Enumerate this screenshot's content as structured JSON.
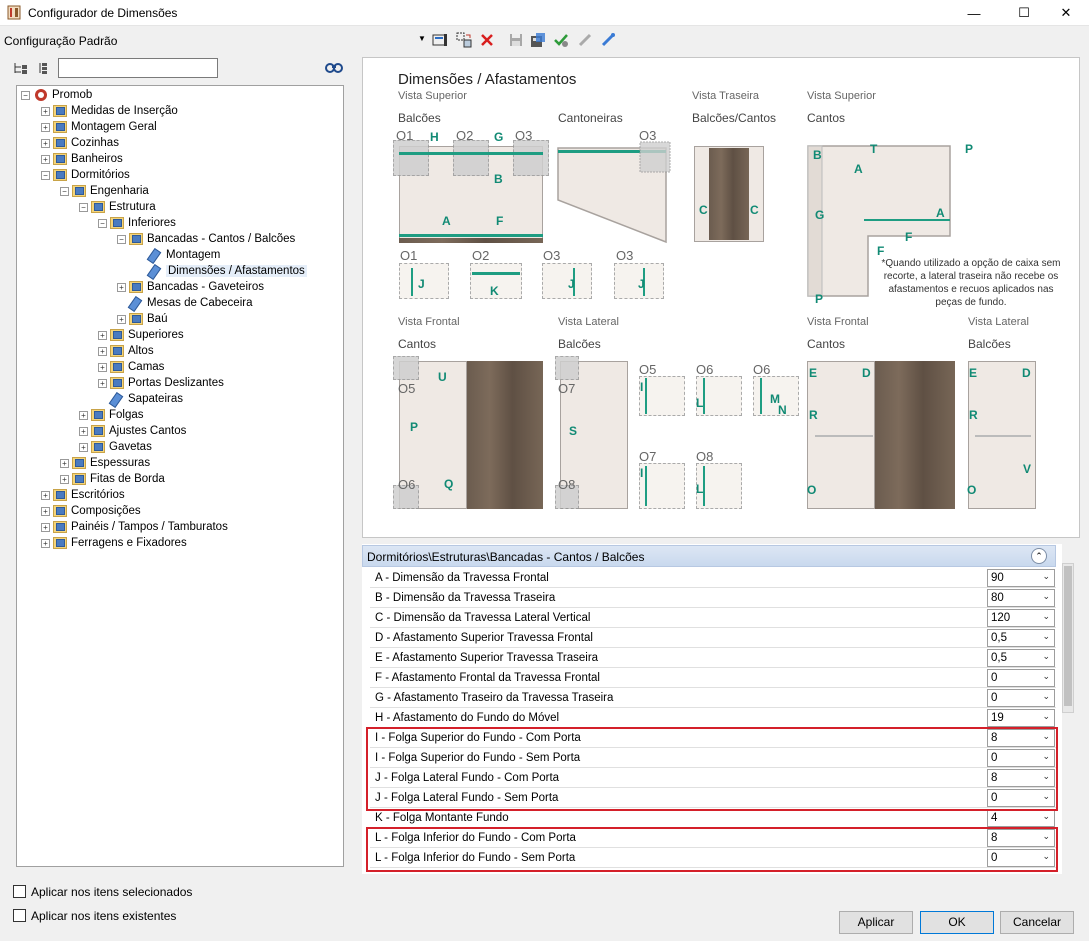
{
  "window": {
    "title": "Configurador de Dimensões",
    "minimize": "—",
    "maximize": "☐",
    "close": "✕"
  },
  "config": {
    "label": "Configuração Padrão",
    "arrow": "▼"
  },
  "toolbar": {
    "icons": [
      "edit-icon",
      "swap-icon",
      "delete-icon",
      "save-icon",
      "export-icon",
      "check-icon",
      "link-icon",
      "unlink-icon"
    ]
  },
  "tree": {
    "root": "Promob",
    "items": [
      "Medidas de Inserção",
      "Montagem Geral",
      "Cozinhas",
      "Banheiros",
      "Dormitórios",
      "Engenharia",
      "Estrutura",
      "Inferiores",
      "Bancadas - Cantos / Balcões",
      "Montagem",
      "Dimensões / Afastamentos",
      "Bancadas - Gaveteiros",
      "Mesas de Cabeceira",
      "Baú",
      "Superiores",
      "Altos",
      "Camas",
      "Portas Deslizantes",
      "Sapateiras",
      "Folgas",
      "Ajustes Cantos",
      "Gavetas",
      "Espessuras",
      "Fitas de Borda",
      "Escritórios",
      "Composições",
      "Painéis / Tampos / Tamburatos",
      "Ferragens e Fixadores"
    ]
  },
  "image": {
    "title": "Dimensões / Afastamentos",
    "vista_superior": "Vista Superior",
    "vista_traseira": "Vista Traseira",
    "vista_frontal": "Vista Frontal",
    "vista_lateral": "Vista Lateral",
    "balcoes": "Balcões",
    "cantoneiras": "Cantoneiras",
    "balcoes_cantos": "Balcões/Cantos",
    "cantos": "Cantos",
    "note": "*Quando utilizado a opção de caixa sem recorte, a lateral traseira não recebe os afastamentos e recuos aplicados nas peças de fundo.",
    "o1": "O1",
    "o2": "O2",
    "o3": "O3",
    "o5": "O5",
    "o6": "O6",
    "o7": "O7",
    "o8": "O8",
    "letters": {
      "A": "A",
      "B": "B",
      "C": "C",
      "D": "D",
      "E": "E",
      "F": "F",
      "G": "G",
      "H": "H",
      "I": "I",
      "J": "J",
      "K": "K",
      "L": "L",
      "M": "M",
      "N": "N",
      "O": "O",
      "P": "P",
      "Q": "Q",
      "R": "R",
      "S": "S",
      "T": "T",
      "U": "U",
      "V": "V"
    }
  },
  "props": {
    "header": "Dormitórios\\Estruturas\\Bancadas - Cantos / Balcões",
    "collapse": "⌃",
    "rows": [
      {
        "name": "A - Dimensão da Travessa Frontal",
        "value": "90"
      },
      {
        "name": "B - Dimensão da Travessa Traseira",
        "value": "80"
      },
      {
        "name": "C - Dimensão da Travessa Lateral Vertical",
        "value": "120"
      },
      {
        "name": "D - Afastamento Superior Travessa Frontal",
        "value": "0,5"
      },
      {
        "name": "E - Afastamento Superior Travessa Traseira",
        "value": "0,5"
      },
      {
        "name": "F - Afastamento Frontal da Travessa Frontal",
        "value": "0"
      },
      {
        "name": "G - Afastamento Traseiro da Travessa Traseira",
        "value": "0"
      },
      {
        "name": "H - Afastamento do Fundo do Móvel",
        "value": "19"
      },
      {
        "name": "I - Folga Superior do Fundo - Com Porta",
        "value": "8"
      },
      {
        "name": "I - Folga Superior do Fundo - Sem Porta",
        "value": "0"
      },
      {
        "name": "J - Folga Lateral Fundo - Com Porta",
        "value": "8"
      },
      {
        "name": "J - Folga Lateral Fundo - Sem Porta",
        "value": "0"
      },
      {
        "name": "K - Folga Montante Fundo",
        "value": "4"
      },
      {
        "name": "L - Folga Inferior do Fundo - Com Porta",
        "value": "8"
      },
      {
        "name": "L - Folga Inferior do Fundo - Sem Porta",
        "value": "0"
      }
    ]
  },
  "options": {
    "selected": "Aplicar nos itens selecionados",
    "existing": "Aplicar nos itens existentes"
  },
  "buttons": {
    "apply": "Aplicar",
    "ok": "OK",
    "cancel": "Cancelar"
  }
}
